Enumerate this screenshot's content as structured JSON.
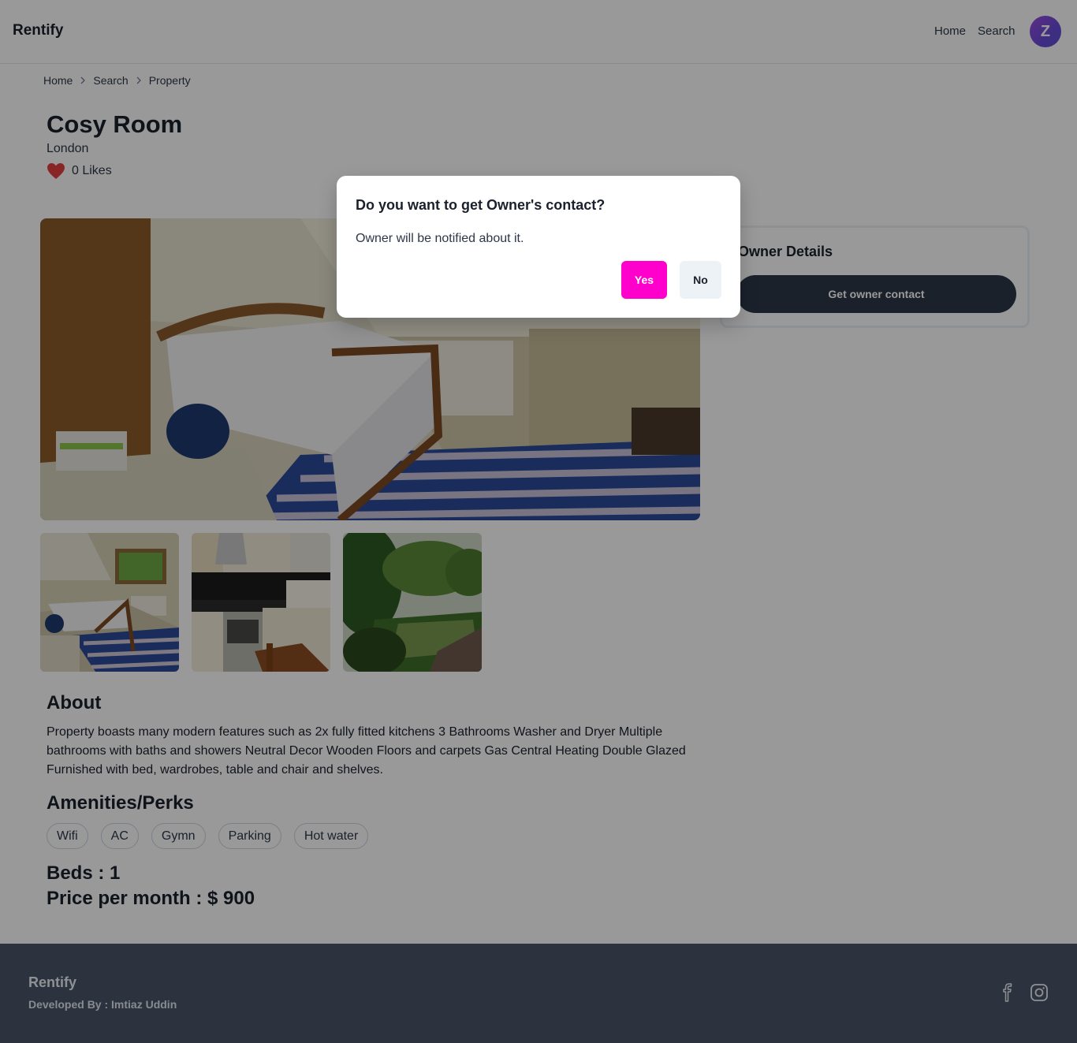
{
  "header": {
    "brand": "Rentify",
    "nav": {
      "home": "Home",
      "search": "Search"
    },
    "avatar_initial": "Z"
  },
  "breadcrumb": [
    "Home",
    "Search",
    "Property"
  ],
  "property": {
    "title": "Cosy Room",
    "location": "London",
    "likes": "0 Likes",
    "photos": [
      "main-bedroom-photo",
      "bedroom-window-photo",
      "kitchen-photo",
      "garden-photo"
    ],
    "about_heading": "About",
    "about_text": "Property boasts many modern features such as 2x fully fitted kitchens 3 Bathrooms Washer and Dryer Multiple bathrooms with baths and showers Neutral Decor Wooden Floors and carpets Gas Central Heating Double Glazed Furnished with bed, wardrobes, table and chair and shelves.",
    "amenities_heading": "Amenities/Perks",
    "amenities": [
      "Wifi",
      "AC",
      "Gymn",
      "Parking",
      "Hot water"
    ],
    "beds": "Beds : 1",
    "price": "Price per month : $ 900"
  },
  "owner": {
    "title": "Owner Details",
    "button": "Get owner contact"
  },
  "modal": {
    "title": "Do you want to get Owner's contact?",
    "body": "Owner will be notified about it.",
    "yes": "Yes",
    "no": "No"
  },
  "footer": {
    "brand": "Rentify",
    "developer": "Developed By : Imtiaz Uddin",
    "icons": [
      "facebook-icon",
      "instagram-icon"
    ]
  },
  "colors": {
    "accent": "#ff00cc",
    "dark": "#2d3748",
    "like": "#e53e3e"
  }
}
